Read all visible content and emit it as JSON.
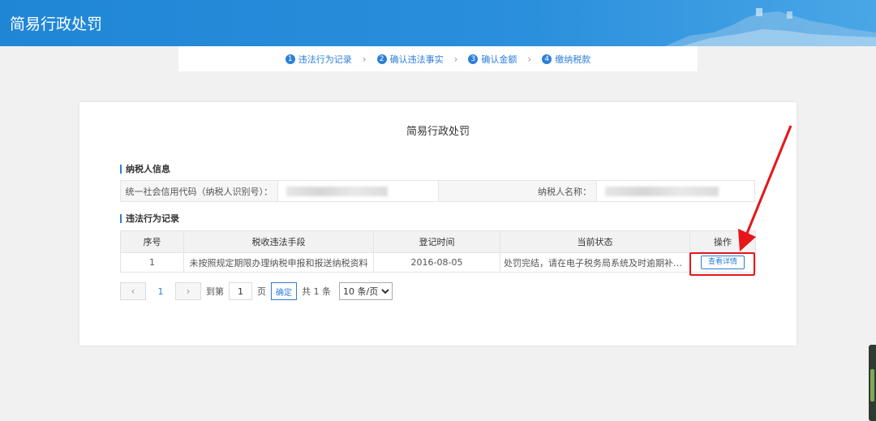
{
  "header": {
    "title": "简易行政处罚"
  },
  "steps": [
    {
      "num": "1",
      "label": "违法行为记录"
    },
    {
      "num": "2",
      "label": "确认违法事实"
    },
    {
      "num": "3",
      "label": "确认金额"
    },
    {
      "num": "4",
      "label": "缴纳税款"
    }
  ],
  "card": {
    "title": "简易行政处罚",
    "taxpayer_section": "纳税人信息",
    "credit_code_label": "统一社会信用代码（纳税人识别号）：",
    "name_label": "纳税人名称：",
    "records_section": "违法行为记录"
  },
  "table": {
    "headers": [
      "序号",
      "税收违法手段",
      "登记时间",
      "当前状态",
      "操作"
    ],
    "rows": [
      {
        "index": "1",
        "means": "未按照规定期限办理纳税申报和报送纳税资料",
        "time": "2016-08-05",
        "status": "处罚完结，请在电子税务局系统及时逾期补报相...",
        "action": "查看详情"
      }
    ]
  },
  "pager": {
    "prev": "‹",
    "next": "›",
    "current": "1",
    "goto_prefix": "到第",
    "goto_value": "1",
    "goto_suffix": "页",
    "confirm": "确定",
    "total": "共 1 条",
    "page_size": "10 条/页"
  },
  "colors": {
    "header_blue": "#1f86d6",
    "accent": "#2b7fd6",
    "highlight_red": "#e8141b"
  }
}
